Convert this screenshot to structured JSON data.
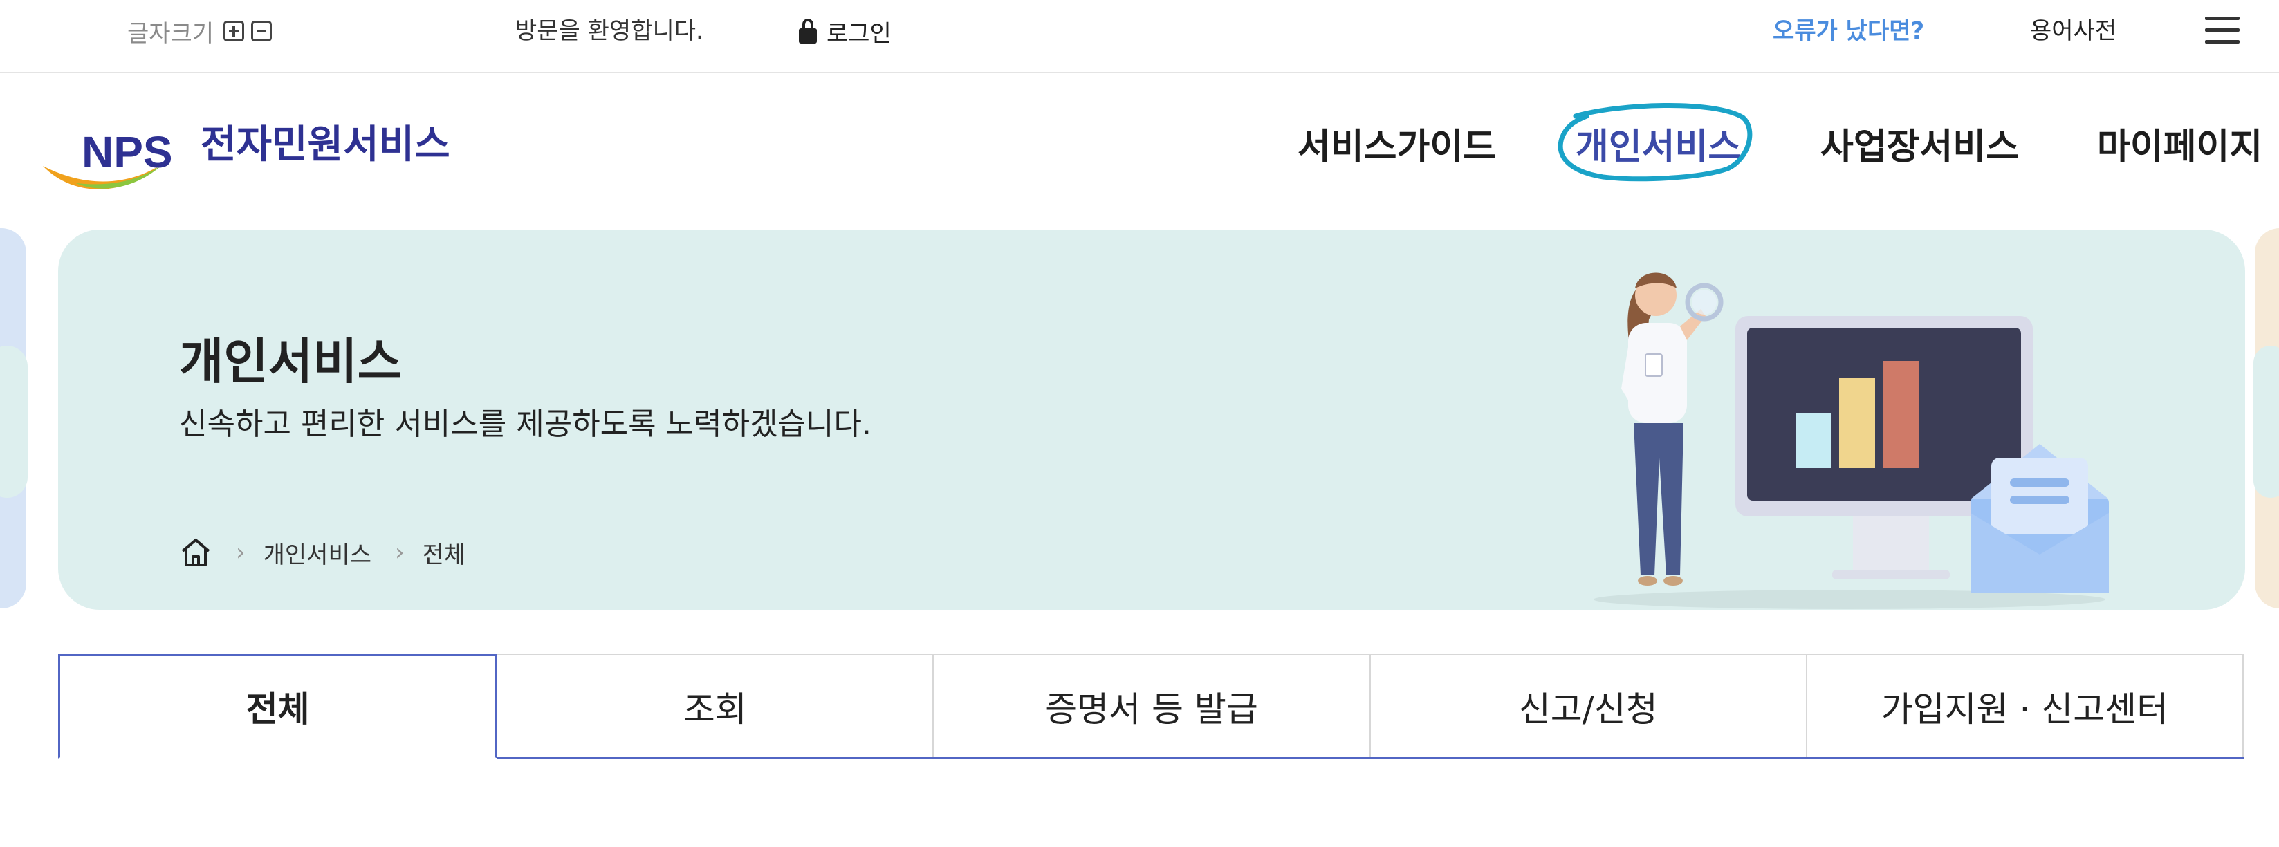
{
  "util": {
    "font_size_label": "글자크기",
    "welcome": "방문을 환영합니다.",
    "login": "로그인",
    "error_link": "오류가 났다면?",
    "dictionary": "용어사전"
  },
  "header": {
    "logo_text": "NPS",
    "logo_sub": "전자민원서비스",
    "nav": [
      "서비스가이드",
      "개인서비스",
      "사업장서비스",
      "마이페이지"
    ],
    "active_nav_index": 1
  },
  "banner": {
    "title": "개인서비스",
    "description": "신속하고 편리한 서비스를 제공하도록 노력하겠습니다.",
    "breadcrumb": [
      "개인서비스",
      "전체"
    ]
  },
  "tabs": {
    "items": [
      "전체",
      "조회",
      "증명서 등 발급",
      "신고/신청",
      "가입지원 · 신고센터"
    ],
    "active_index": 0
  },
  "colors": {
    "brand_navy": "#2e3192",
    "active_nav": "#3b4aa8",
    "error_link": "#4a8cde",
    "banner_bg": "#ddefee",
    "tab_accent": "#5266c4",
    "annotation_circle": "#1aa3c8"
  },
  "icons": [
    "plus-square-icon",
    "minus-square-icon",
    "lock-icon",
    "hamburger-menu-icon",
    "home-icon",
    "chevron-right-icon"
  ]
}
